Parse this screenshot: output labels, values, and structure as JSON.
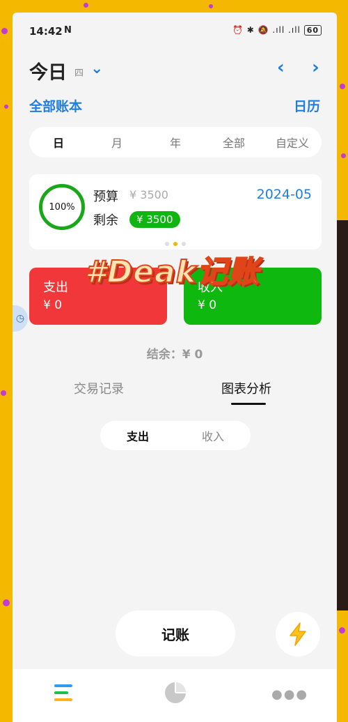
{
  "status_bar": {
    "time": "14:42",
    "nfc": "N",
    "icons": "⏰ ✱ 🔕 .ıll .ıll",
    "battery": "60"
  },
  "header": {
    "title": "今日",
    "weekday": "四",
    "all_books": "全部账本",
    "calendar": "日历"
  },
  "period_tabs": [
    "日",
    "月",
    "年",
    "全部",
    "自定义"
  ],
  "budget": {
    "progress": "100%",
    "progress_fraction": 1.0,
    "label": "预算",
    "value": "¥ 3500",
    "month": "2024-05",
    "remain_label": "剩余",
    "remain_value": "¥ 3500"
  },
  "watermark": "#Deak记账",
  "expense": {
    "label": "支出",
    "value": "¥ 0"
  },
  "income": {
    "label": "收入",
    "value": "¥ 0"
  },
  "balance": "结余：¥ 0",
  "view_tabs": {
    "records": "交易记录",
    "charts": "图表分析"
  },
  "segment": {
    "expense": "支出",
    "income": "收入"
  },
  "actions": {
    "record": "记账"
  },
  "colors": {
    "accent": "#1f7ee0",
    "expense": "#f2373a",
    "income": "#0fb80f",
    "frame": "#f5b800"
  }
}
